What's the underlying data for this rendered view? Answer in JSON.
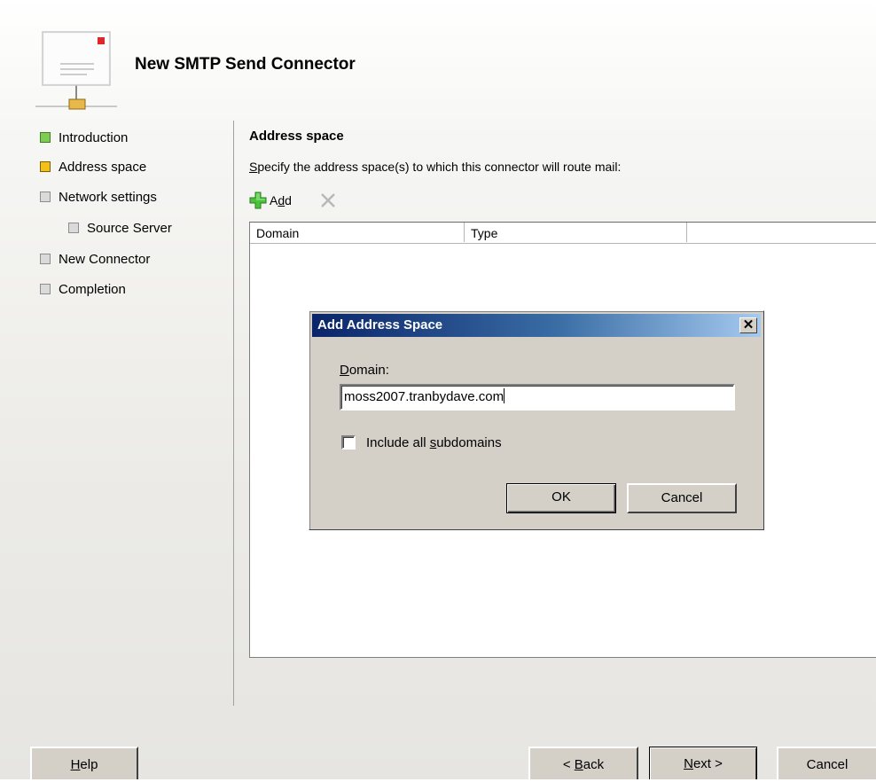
{
  "header": {
    "title": "New SMTP Send Connector"
  },
  "nav": {
    "items": [
      {
        "label": "Introduction",
        "state": "complete",
        "color": "#7fcc52"
      },
      {
        "label": "Address space",
        "state": "current",
        "color": "#f2c018"
      },
      {
        "label": "Network settings",
        "state": "pending",
        "color": "#dadada"
      },
      {
        "label": "Source Server",
        "state": "pending",
        "color": "#dadada"
      },
      {
        "label": "New Connector",
        "state": "pending",
        "color": "#dadada"
      },
      {
        "label": "Completion",
        "state": "pending",
        "color": "#dadada"
      }
    ]
  },
  "main": {
    "section_title": "Address space",
    "instruction_first": "S",
    "instruction_rest": "pecify the address space(s) to which this connector will route mail:",
    "toolbar": {
      "add_a": "A",
      "add_d": "d",
      "add_rest": "d"
    },
    "list": {
      "columns": [
        "Domain",
        "Type",
        ""
      ]
    }
  },
  "dialog": {
    "title": "Add Address Space",
    "close_glyph": "✕",
    "domain_label_first": "D",
    "domain_label_rest": "omain:",
    "domain_value": "moss2007.tranbydave.com",
    "subdomains_label_pre": "Include all ",
    "subdomains_label_key": "s",
    "subdomains_label_post": "ubdomains",
    "subdomains_checked": false,
    "ok_label": "OK",
    "cancel_label": "Cancel"
  },
  "footer": {
    "help_key": "H",
    "help_rest": "elp",
    "back_pre": "< ",
    "back_key": "B",
    "back_rest": "ack",
    "next_key": "N",
    "next_rest": "ext >",
    "cancel_label": "Cancel"
  },
  "icons": {
    "header_icon": "smtp-connector-icon",
    "add_icon": "green-plus-icon",
    "remove_icon": "gray-x-icon"
  }
}
